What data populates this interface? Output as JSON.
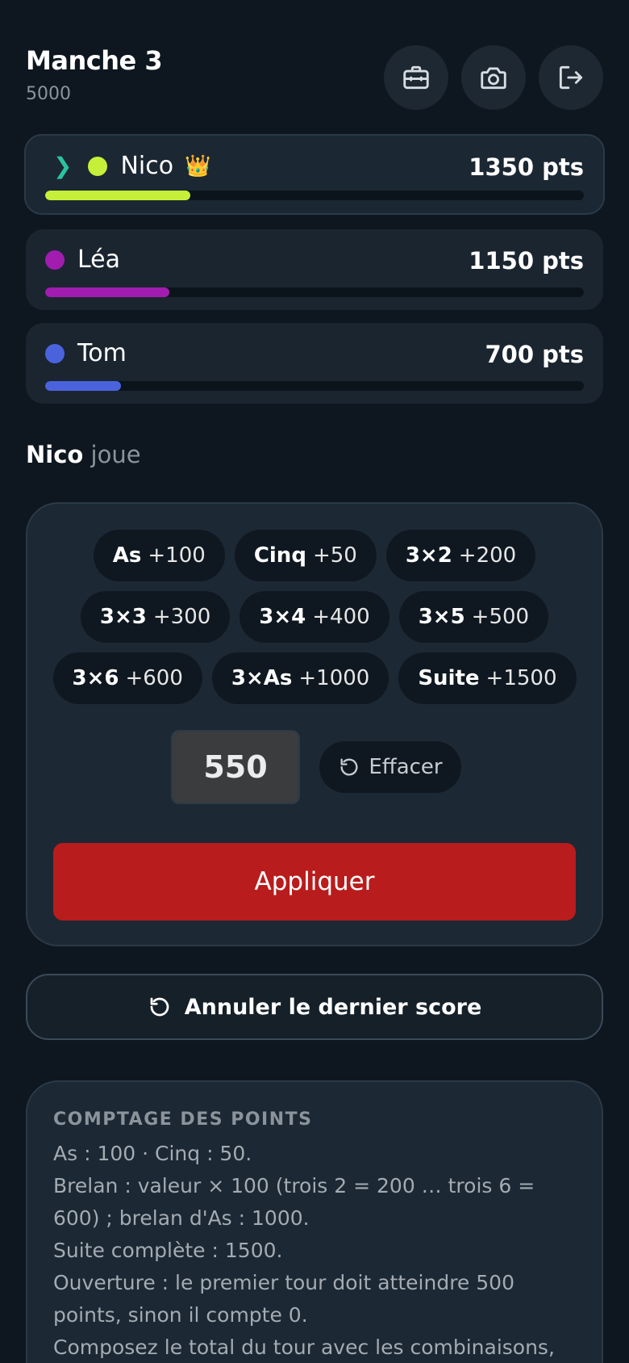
{
  "header": {
    "title": "Manche 3",
    "target": "5000",
    "buttons": [
      {
        "icon": "toolbox-icon"
      },
      {
        "icon": "camera-icon"
      },
      {
        "icon": "logout-icon"
      }
    ]
  },
  "players": [
    {
      "name": "Nico",
      "points": "1350 pts",
      "color": "#c6ef3a",
      "progress": 0.27,
      "active": true,
      "leader": true,
      "crown": "👑"
    },
    {
      "name": "Léa",
      "points": "1150 pts",
      "color": "#a21caf",
      "progress": 0.23,
      "active": false
    },
    {
      "name": "Tom",
      "points": "700 pts",
      "color": "#4a63dd",
      "progress": 0.14,
      "active": false
    }
  ],
  "turn": {
    "player": "Nico",
    "label": "joue"
  },
  "combos": [
    [
      {
        "name": "As",
        "pts": "+100"
      },
      {
        "name": "Cinq",
        "pts": "+50"
      },
      {
        "name": "3×2",
        "pts": "+200"
      }
    ],
    [
      {
        "name": "3×3",
        "pts": "+300"
      },
      {
        "name": "3×4",
        "pts": "+400"
      },
      {
        "name": "3×5",
        "pts": "+500"
      }
    ],
    [
      {
        "name": "3×6",
        "pts": "+600"
      },
      {
        "name": "3×As",
        "pts": "+1000"
      },
      {
        "name": "Suite",
        "pts": "+1500"
      }
    ]
  ],
  "score_input": {
    "value": "550"
  },
  "clear_label": "Effacer",
  "apply_label": "Appliquer",
  "undo_label": "Annuler le dernier score",
  "rules": {
    "heading": "COMPTAGE DES POINTS",
    "lines": [
      "As : 100 · Cinq : 50.",
      "Brelan : valeur × 100 (trois 2 = 200 … trois 6 = 600) ; brelan d'As : 1000.",
      "Suite complète : 1500.",
      "Ouverture : le premier tour doit atteindre 500 points, sinon il compte 0.",
      "Composez le total du tour avec les combinaisons,"
    ]
  }
}
